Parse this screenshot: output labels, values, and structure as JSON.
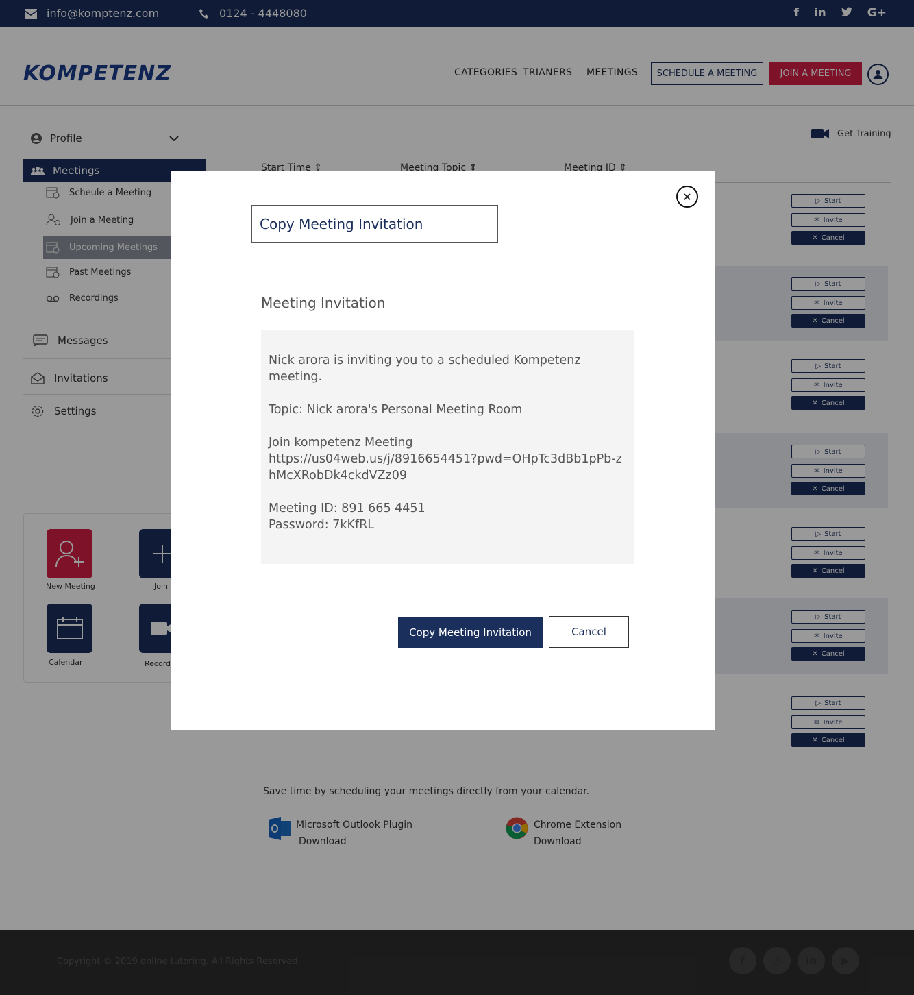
{
  "topbar": {
    "email": "info@komptenz.com",
    "phone": "0124 - 4448080",
    "social": [
      "f",
      "in",
      "t",
      "G+"
    ]
  },
  "header": {
    "logo": "KOMPETENZ",
    "nav": [
      "CATEGORIES",
      "TRIANERS",
      "MEETINGS"
    ],
    "schedule_btn": "SCHEDULE A MEETING",
    "join_btn": "JOIN A MEETING"
  },
  "sidebar": {
    "profile": "Profile",
    "meetings": "Meetings",
    "sub": [
      "Scheule a Meeting",
      "Join a Meeting",
      "Upcoming Meetings",
      "Past Meetings",
      "Recordings"
    ],
    "messages": "Messages",
    "invitations": "Invitations",
    "settings": "Settings"
  },
  "quick": {
    "new_meeting": "New Meeting",
    "join": "Join",
    "calendar": "Calendar",
    "record": "Record"
  },
  "main": {
    "get_training": "Get Training",
    "columns": [
      "Start Time",
      "Meeting Topic",
      "Meeting ID"
    ],
    "actions": {
      "start": "Start",
      "invite": "Invite",
      "cancel": "Cancel"
    },
    "calendar_text": "Save time by scheduling your meetings directly from your calendar.",
    "outlook": {
      "name": "Microsoft Outlook Plugin",
      "download": "Download"
    },
    "chrome": {
      "name": "Chrome Extension",
      "download": "Download"
    }
  },
  "footer": {
    "copyright": "Copyright © 2019 online tutoring. All Rights Reserved."
  },
  "modal": {
    "title": "Copy Meeting Invitation",
    "heading": "Meeting Invitation",
    "line1": "Nick arora is inviting you to a scheduled Kompetenz meeting.",
    "topic": "Topic: Nick arora's Personal Meeting Room",
    "join_label": "Join kompetenz  Meeting",
    "join_url": "https://us04web.us/j/8916654451?pwd=OHpTc3dBb1pPb-zhMcXRobDk4ckdVZz09",
    "meeting_id": "Meeting ID: 891 665 4451",
    "password": "Password: 7kKfRL",
    "copy_btn": "Copy Meeting Invitation",
    "cancel_btn": "Cancel"
  },
  "colors": {
    "navy": "#1b2f5c",
    "red": "#d31f45"
  }
}
